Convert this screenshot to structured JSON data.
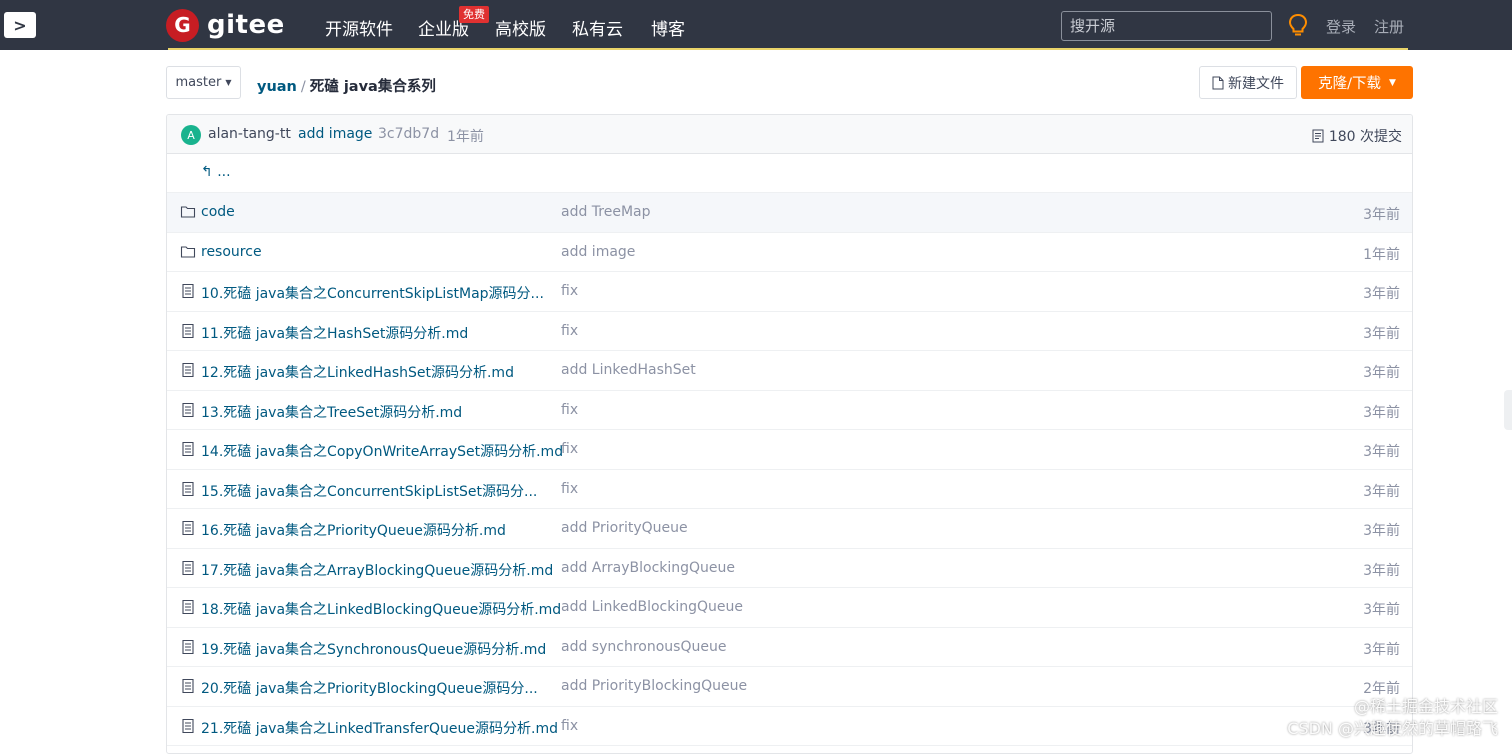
{
  "topbar": {
    "toggle_glyph": ">",
    "logo_text": "gitee",
    "logo_mark": "G",
    "nav": [
      "开源软件",
      "企业版",
      "高校版",
      "私有云",
      "博客"
    ],
    "free_badge": "免费",
    "search_placeholder": "搜开源",
    "login": "登录",
    "register": "注册",
    "accent_color": "#c71d23"
  },
  "repo": {
    "branch": "master",
    "owner": "yuan",
    "separator": "/",
    "name": "死磕 java集合系列",
    "new_file_label": "新建文件",
    "clone_label": "克隆/下载",
    "clone_color": "#fe7300"
  },
  "commit": {
    "avatar_letter": "A",
    "author": "alan-tang-tt",
    "message": "add image",
    "sha": "3c7db7d",
    "time": "1年前",
    "count_label": "180 次提交"
  },
  "parent_link": "...",
  "files": [
    {
      "type": "folder",
      "name": "code",
      "message": "add TreeMap",
      "time": "3年前"
    },
    {
      "type": "folder",
      "name": "resource",
      "message": "add image",
      "time": "1年前"
    },
    {
      "type": "file",
      "name": "10.死磕 java集合之ConcurrentSkipListMap源码分...",
      "message": "fix",
      "time": "3年前"
    },
    {
      "type": "file",
      "name": "11.死磕 java集合之HashSet源码分析.md",
      "message": "fix",
      "time": "3年前"
    },
    {
      "type": "file",
      "name": "12.死磕 java集合之LinkedHashSet源码分析.md",
      "message": "add LinkedHashSet",
      "time": "3年前"
    },
    {
      "type": "file",
      "name": "13.死磕 java集合之TreeSet源码分析.md",
      "message": "fix",
      "time": "3年前"
    },
    {
      "type": "file",
      "name": "14.死磕 java集合之CopyOnWriteArraySet源码分析.md",
      "message": "fix",
      "time": "3年前"
    },
    {
      "type": "file",
      "name": "15.死磕 java集合之ConcurrentSkipListSet源码分...",
      "message": "fix",
      "time": "3年前"
    },
    {
      "type": "file",
      "name": "16.死磕 java集合之PriorityQueue源码分析.md",
      "message": "add PriorityQueue",
      "time": "3年前"
    },
    {
      "type": "file",
      "name": "17.死磕 java集合之ArrayBlockingQueue源码分析.md",
      "message": "add ArrayBlockingQueue",
      "time": "3年前"
    },
    {
      "type": "file",
      "name": "18.死磕 java集合之LinkedBlockingQueue源码分析.md",
      "message": "add LinkedBlockingQueue",
      "time": "3年前"
    },
    {
      "type": "file",
      "name": "19.死磕 java集合之SynchronousQueue源码分析.md",
      "message": "add synchronousQueue",
      "time": "3年前"
    },
    {
      "type": "file",
      "name": "20.死磕 java集合之PriorityBlockingQueue源码分...",
      "message": "add PriorityBlockingQueue",
      "time": "2年前"
    },
    {
      "type": "file",
      "name": "21.死磕 java集合之LinkedTransferQueue源码分析.md",
      "message": "fix",
      "time": "3年前"
    }
  ],
  "watermark": {
    "line1": "@稀土掘金技术社区",
    "line2": "CSDN @兴趣使然的草帽路飞"
  }
}
